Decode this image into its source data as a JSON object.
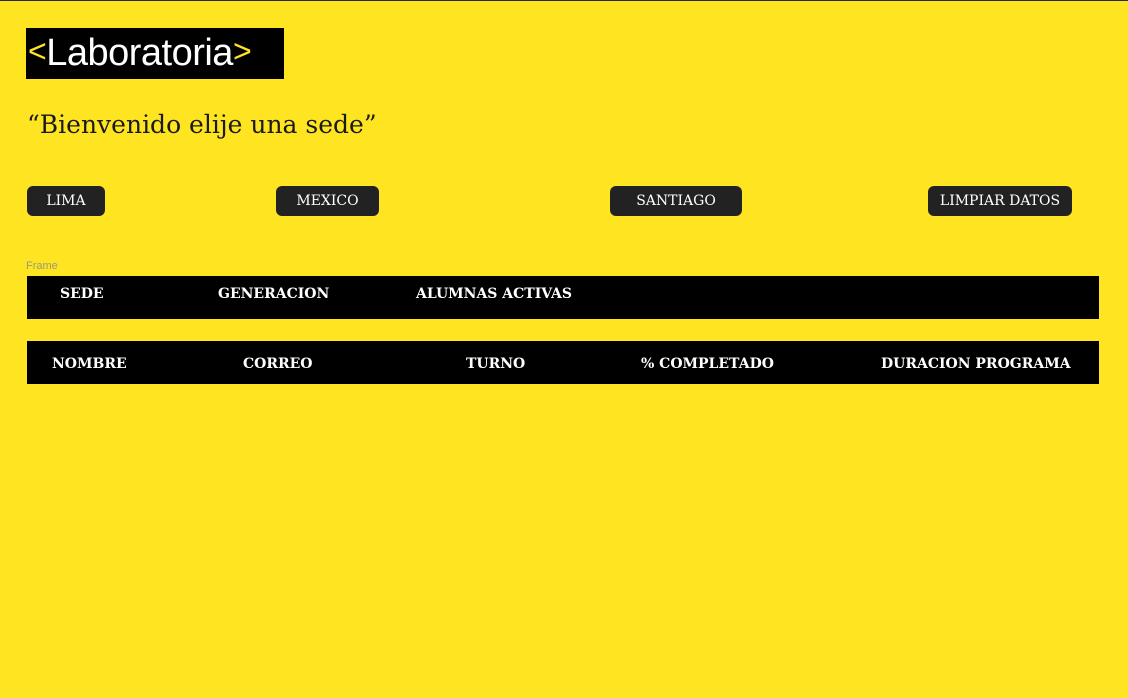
{
  "logo": {
    "left_bracket": "<",
    "text": "Laboratoria",
    "right_bracket": ">"
  },
  "welcome": "“Bienvenido elije una sede”",
  "buttons": {
    "lima": "LIMA",
    "mexico": "MEXICO",
    "santiago": "SANTIAGO",
    "limpiar": "LIMPIAR DATOS"
  },
  "frame_label": "Frame",
  "sede_table": {
    "headers": [
      "SEDE",
      "GENERACION",
      "ALUMNAS ACTIVAS"
    ]
  },
  "students_table": {
    "headers": [
      "NOMBRE",
      "CORREO",
      "TURNO",
      "% COMPLETADO",
      "DURACION PROGRAMA"
    ]
  },
  "colors": {
    "background": "#FFE521",
    "bar": "#000000",
    "button": "#222222"
  }
}
